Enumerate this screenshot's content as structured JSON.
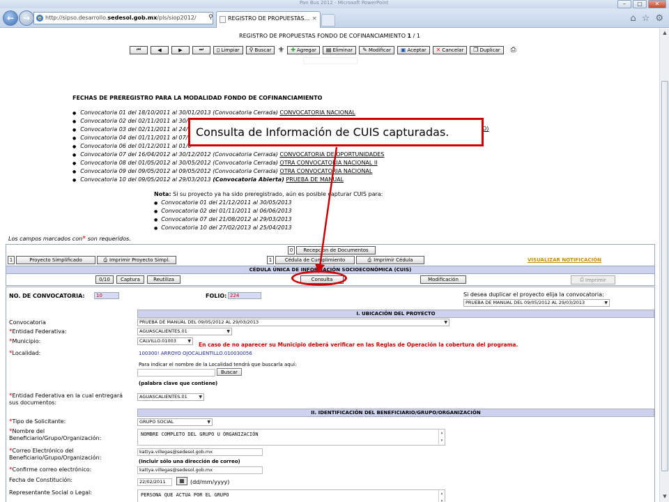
{
  "browser": {
    "window_title": "Pan Bus 2012 - Microsoft PowerPoint",
    "address": {
      "prefix": "http://sipso.desarrollo.",
      "domain": "sedesol.gob.mx",
      "path": "/pls/siop2012/"
    },
    "address_icons": "⚲ ▾ ⟳ ✕",
    "tab_title": "REGISTRO DE PROPUESTAS...",
    "tab_close": "×",
    "window_buttons": {
      "minimize": "–",
      "maximize": "□",
      "close": "✕"
    },
    "chrome_icons": {
      "home": "⌂",
      "favorites": "☆",
      "tools": "⚙"
    }
  },
  "page": {
    "heading_text": "REGISTRO DE PROPUESTAS FONDO DE COFINANCIAMIENTO ",
    "heading_page": "1",
    "heading_sep": " / ",
    "heading_total": "1",
    "toolbar": {
      "first": "⏮",
      "prev": "◀",
      "next": "▶",
      "last": "⏭",
      "limpiar": "Limpiar",
      "buscar": "Buscar",
      "agregar": "Agregar",
      "eliminar": "Eliminar",
      "modificar": "Modificar",
      "aceptar": "Aceptar",
      "cancelar": "Cancelar",
      "duplicar": "Duplicar"
    },
    "fechas_title": "FECHAS DE PREREGISTRO PARA LA MODALIDAD FONDO DE COFINANCIAMIENTO",
    "convocatorias": [
      {
        "text": "Convocatoria 01 del 18/10/2011 al 30/01/2013 (Convocatoria Cerrada) ",
        "link": "CONVOCATORIA NACIONAL"
      },
      {
        "text": "Convocatoria 02 del 02/11/2011 al 30/0",
        "link": ""
      },
      {
        "text": "Convocatoria 03 del 02/11/2011 al 24/1",
        "link": ""
      },
      {
        "text": "Convocatoria 04 del 01/11/2011 al 07/1",
        "link": ""
      },
      {
        "text": "Convocatoria 06 del 01/12/2011 al 01/0",
        "link": ""
      },
      {
        "text": "Convocatoria 07 del 16/04/2012 al 30/12/2012 (Convocatoria Cerrada) ",
        "link": "CONVOCATORIA DE OPORTUNIDADES"
      },
      {
        "text": "Convocatoria 08 del 01/05/2012 al 30/05/2012 (Convocatoria Cerrada) ",
        "link": "OTRA CONVOCATORIA NACIONAL II"
      },
      {
        "text": "Convocatoria 09 del 09/05/2012 al 09/05/2012 (Convocatoria Cerrada) ",
        "link": "OTRA CONVOCATORIA NACIONAL"
      }
    ],
    "conv10": {
      "text": "Convocatoria 10 del 09/05/2012 al 29/03/2013 ",
      "status": "(Convocatoria Abierta)",
      "link": "PRUEBA DE MANUAL"
    },
    "link_fragment": "O)",
    "nota": {
      "label": "Nota:",
      "text": " Si su proyecto ya ha sido preregistrado, aún es posible capturar CUIS para:",
      "items": [
        "Convocatoria 01 del 21/12/2011 al 30/05/2013",
        "Convocatoria 02 del 01/11/2011 al 06/06/2013",
        "Convocatoria 07 del 21/08/2012 al 29/03/2013",
        "Convocatoria 10 del 27/02/2013 al 25/04/2013"
      ]
    },
    "required_note_before": "Los campos marcados con",
    "required_star": "*",
    "required_note_after": " son requeridos.",
    "panel": {
      "recepcion_count": "0",
      "recepcion_label": "Recepcion de Documentos",
      "proyecto_count": "1",
      "proyecto_label": "Proyecto Simplificado",
      "imprimir_proyecto": "Imprimir Proyecto Simpl.",
      "cedula_count": "1",
      "cedula_label": "Cédula de Cumplimiento",
      "imprimir_cedula": "Imprimir Cédula",
      "visualizar": "VISUALIZAR NOTIFICACIÓN",
      "cuis_title": "CÉDULA ÚNICA DE INFORMACIÓN SOCIOECONÓMICA (CUIS)",
      "cuis_count": "0/10",
      "captura": "Captura",
      "reutiliza": "Reutiliza",
      "consulta": "Consulta",
      "modificacion": "Modificación",
      "imprimir": "Imprimir"
    },
    "form": {
      "no_convocatoria_label": "NO. DE CONVOCATORIA:",
      "no_convocatoria_value": "10",
      "folio_label": "FOLIO:",
      "folio_value": "224",
      "duplicar_label": "Si desea duplicar el proyecto elija la convocatoria:",
      "duplicar_value": "PRUEBA DE MANUAL DEL 09/05/2012 AL 29/03/2013",
      "sec1": "I. UBICACIÓN DEL PROYECTO",
      "convocatoria_label": "Convocatoria",
      "convocatoria_value": "PRUEBA DE MANUAL DEL 09/05/2012 AL 29/03/2013",
      "entidad_label": "Entidad Federativa:",
      "entidad_value": "AGUASCALIENTES.01",
      "municipio_label": "Municipio:",
      "municipio_value": "CALVILLO.01003",
      "municipio_warning": "En caso de no aparecer su Municipio deberá verificar en las Reglas de Operación la cobertura del programa.",
      "localidad_label": "Localidad:",
      "localidad_value": "100300! ARROYO OJOCALIENTILLO.010030056",
      "localidad_hint": "Para indicar el nombre de la Localidad tendrá que buscarla aquí:",
      "buscar": "Buscar",
      "palabra_clave": "(palabra clave que contiene)",
      "entidad2_label_1": "Entidad Federativa en la cual entregará",
      "entidad2_label_2": "sus documentos:",
      "entidad2_value": "AGUASCALIENTES.01",
      "sec2": "II. IDENTIFICACIÓN DEL BENEFICIARIO/GRUPO/ORGANIZACIÓN",
      "tipo_label": "Tipo de Solicitante:",
      "tipo_value": "GRUPO SOCIAL",
      "nombre_label_1": "Nombre del",
      "nombre_label_2": "Beneficiario/Grupo/Organización:",
      "nombre_value": "NOMBRE COMPLETO DEL GRUPO U ORGANIZACIÓN",
      "correo_label_1": "Correo Electrónico del",
      "correo_label_2": "Beneficiario/Grupo/Organización:",
      "correo_value": "kattya.villegas@sedesol.gob.mx",
      "correo_hint": "(Incluir sólo una dirección de correo)",
      "confirme_label": "Confirme correo electrónico:",
      "confirme_value": "kattya.villegas@sedesol.gob.mx",
      "fecha_label": "Fecha de Constitución:",
      "fecha_value": "22/02/2011",
      "fecha_format": "(dd/mm/yyyy)",
      "representante_label": "Representante Social o Legal:",
      "representante_value": "PERSONA QUE ACTUA POR EL GRUPO"
    }
  },
  "annotation": {
    "callout_text": "Consulta de Información de CUIS capturadas.",
    "color": "#cc0000"
  }
}
